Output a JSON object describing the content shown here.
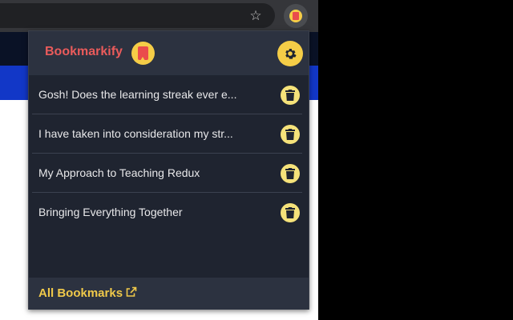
{
  "browser": {
    "star_icon": "star-outline-icon",
    "extension_icon": "bookmarkify-extension-icon",
    "colors": {
      "toolbar": "#35363a",
      "page_dark": "#0a1226",
      "page_blue": "#1237c7"
    }
  },
  "popup": {
    "brand": "Bookmarkify",
    "settings_icon": "gear-icon",
    "bookmarks": [
      {
        "title": "Gosh! Does the learning streak ever e..."
      },
      {
        "title": "I have taken into consideration my str..."
      },
      {
        "title": "My Approach to Teaching Redux"
      },
      {
        "title": "Bringing Everything Together"
      }
    ],
    "footer_link": "All Bookmarks",
    "colors": {
      "accent": "#f5cd47",
      "brand": "#ea5b5b",
      "background": "#1f2430",
      "header": "#2c3240",
      "link": "#f0c94a"
    }
  }
}
